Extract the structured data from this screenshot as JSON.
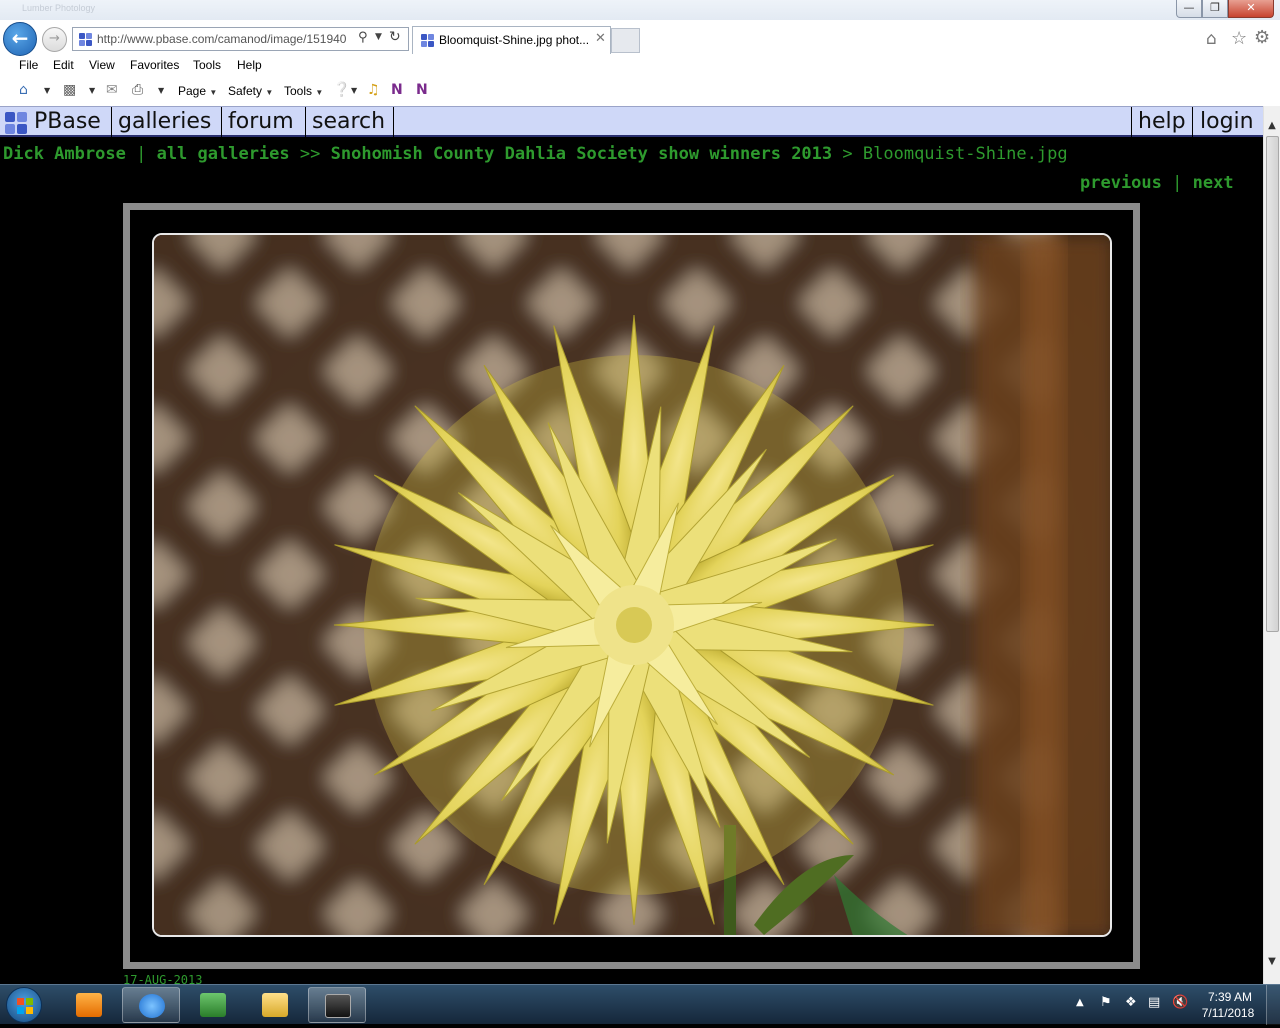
{
  "window": {
    "background_title": "Lumber Photology"
  },
  "browser": {
    "url": "http://www.pbase.com/camanod/image/151940",
    "tab_title": "Bloomquist-Shine.jpg phot...",
    "menu": [
      "File",
      "Edit",
      "View",
      "Favorites",
      "Tools",
      "Help"
    ],
    "command_bar": {
      "page_label": "Page",
      "safety_label": "Safety",
      "tools_label": "Tools"
    }
  },
  "pbase": {
    "nav_left": [
      "PBase",
      "galleries",
      "forum",
      "search"
    ],
    "nav_right": [
      "help",
      "login"
    ],
    "colors": {
      "header_bg": "#cfd8f8",
      "link_green": "#2e9a2e"
    }
  },
  "breadcrumb": {
    "user": "Dick Ambrose",
    "sep1": "|",
    "all_galleries": "all galleries",
    "sep2": ">>",
    "gallery": "Snohomish County Dahlia Society show winners 2013",
    "sep3": ">",
    "current": "Bloomquist-Shine.jpg"
  },
  "pager": {
    "previous": "previous",
    "sep": "|",
    "next": "next"
  },
  "photo": {
    "subject": "yellow cactus dahlia in front of wooden lattice",
    "date": "17-AUG-2013"
  },
  "taskbar": {
    "clock_time": "7:39 AM",
    "clock_date": "7/11/2018"
  }
}
